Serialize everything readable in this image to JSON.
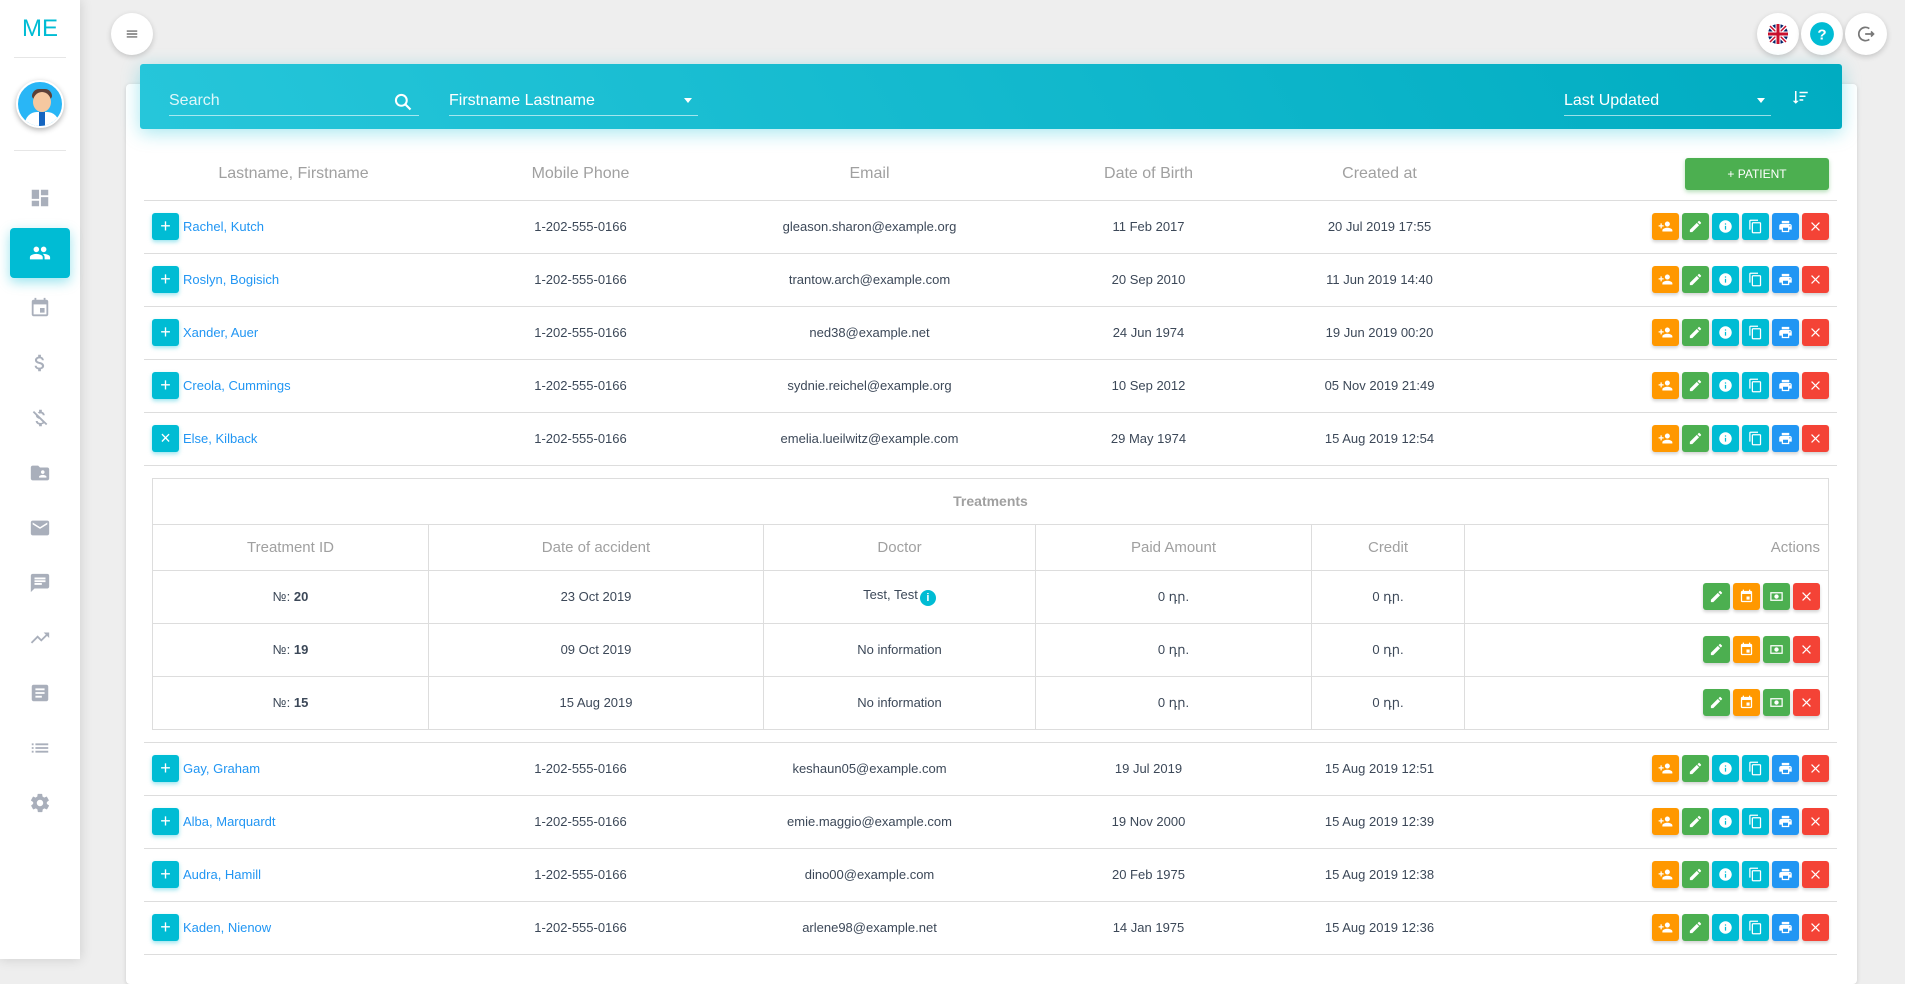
{
  "app": {
    "brand": "ME"
  },
  "colors": {
    "accent": "#00bcd4",
    "success": "#4caf50",
    "warning": "#ff9800",
    "info": "#2196f3",
    "danger": "#f44336"
  },
  "sidebar": {
    "items": [
      {
        "icon": "dashboard-icon",
        "active": false
      },
      {
        "icon": "patients-icon",
        "active": true
      },
      {
        "icon": "calendar-icon",
        "active": false
      },
      {
        "icon": "dollar-icon",
        "active": false
      },
      {
        "icon": "money-off-icon",
        "active": false
      },
      {
        "icon": "folder-shared-icon",
        "active": false
      },
      {
        "icon": "mail-icon",
        "active": false
      },
      {
        "icon": "chat-icon",
        "active": false
      },
      {
        "icon": "trending-up-icon",
        "active": false
      },
      {
        "icon": "article-icon",
        "active": false
      },
      {
        "icon": "list-icon",
        "active": false
      },
      {
        "icon": "settings-icon",
        "active": false
      }
    ]
  },
  "topbar": {
    "icons": [
      "menu-icon",
      "uk-flag-icon",
      "help-icon",
      "logout-icon"
    ]
  },
  "filters": {
    "search_placeholder": "Search",
    "name_format": "Firstname Lastname",
    "sort_by": "Last Updated"
  },
  "patients": {
    "columns": [
      "Lastname, Firstname",
      "Mobile Phone",
      "Email",
      "Date of Birth",
      "Created at"
    ],
    "add_label": "+ PATIENT",
    "rows_top": [
      {
        "name": "Rachel, Kutch",
        "phone": "1-202-555-0166",
        "email": "gleason.sharon@example.org",
        "dob": "11 Feb 2017",
        "created": "20 Jul 2019 17:55",
        "toggle": "+"
      },
      {
        "name": "Roslyn, Bogisich",
        "phone": "1-202-555-0166",
        "email": "trantow.arch@example.com",
        "dob": "20 Sep 2010",
        "created": "11 Jun 2019 14:40",
        "toggle": "+"
      },
      {
        "name": "Xander, Auer",
        "phone": "1-202-555-0166",
        "email": "ned38@example.net",
        "dob": "24 Jun 1974",
        "created": "19 Jun 2019 00:20",
        "toggle": "+"
      },
      {
        "name": "Creola, Cummings",
        "phone": "1-202-555-0166",
        "email": "sydnie.reichel@example.org",
        "dob": "10 Sep 2012",
        "created": "05 Nov 2019 21:49",
        "toggle": "+"
      },
      {
        "name": "Else, Kilback",
        "phone": "1-202-555-0166",
        "email": "emelia.lueilwitz@example.com",
        "dob": "29 May 1974",
        "created": "15 Aug 2019 12:54",
        "toggle": "×"
      }
    ],
    "rows_bottom": [
      {
        "name": "Gay, Graham",
        "phone": "1-202-555-0166",
        "email": "keshaun05@example.com",
        "dob": "19 Jul 2019",
        "created": "15 Aug 2019 12:51",
        "toggle": "+"
      },
      {
        "name": "Alba, Marquardt",
        "phone": "1-202-555-0166",
        "email": "emie.maggio@example.com",
        "dob": "19 Nov 2000",
        "created": "15 Aug 2019 12:39",
        "toggle": "+"
      },
      {
        "name": "Audra, Hamill",
        "phone": "1-202-555-0166",
        "email": "dino00@example.com",
        "dob": "20 Feb 1975",
        "created": "15 Aug 2019 12:38",
        "toggle": "+"
      },
      {
        "name": "Kaden, Nienow",
        "phone": "1-202-555-0166",
        "email": "arlene98@example.net",
        "dob": "14 Jan 1975",
        "created": "15 Aug 2019 12:36",
        "toggle": "+"
      }
    ],
    "row_actions": [
      "assign-user-icon",
      "edit-icon",
      "info-icon",
      "copy-icon",
      "print-icon",
      "delete-icon"
    ]
  },
  "treatments": {
    "title": "Treatments",
    "columns": [
      "Treatment ID",
      "Date of accident",
      "Doctor",
      "Paid Amount",
      "Credit",
      "Actions"
    ],
    "id_prefix": "№:",
    "rows": [
      {
        "id": "20",
        "date": "23 Oct 2019",
        "doctor": "Test, Test",
        "doctor_info": true,
        "paid": "0 դր.",
        "credit": "0 դր."
      },
      {
        "id": "19",
        "date": "09 Oct 2019",
        "doctor": "No information",
        "doctor_info": false,
        "paid": "0 դր.",
        "credit": "0 դր."
      },
      {
        "id": "15",
        "date": "15 Aug 2019",
        "doctor": "No information",
        "doctor_info": false,
        "paid": "0 դր.",
        "credit": "0 դր."
      }
    ],
    "row_actions": [
      "edit-icon",
      "calendar-icon",
      "payment-icon",
      "delete-icon"
    ]
  }
}
